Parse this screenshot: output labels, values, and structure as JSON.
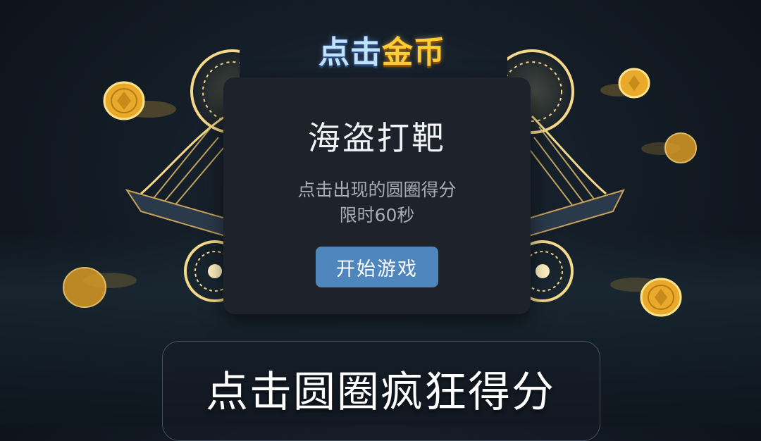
{
  "logo": {
    "part_a": "点击",
    "part_b": "金币"
  },
  "dialog": {
    "title": "海盗打靶",
    "description_line1": "点击出现的圆圈得分",
    "description_line2": "限时60秒",
    "start_button": "开始游戏"
  },
  "banner": {
    "text": "点击圆圈疯狂得分"
  },
  "colors": {
    "button": "#4f86be",
    "panel": "#1d222b",
    "gold": "#f0b73a",
    "rune_glow": "#f5d98a"
  },
  "icons": [
    "gold-coin-icon",
    "pirate-ship-icon",
    "rune-circle-icon"
  ]
}
